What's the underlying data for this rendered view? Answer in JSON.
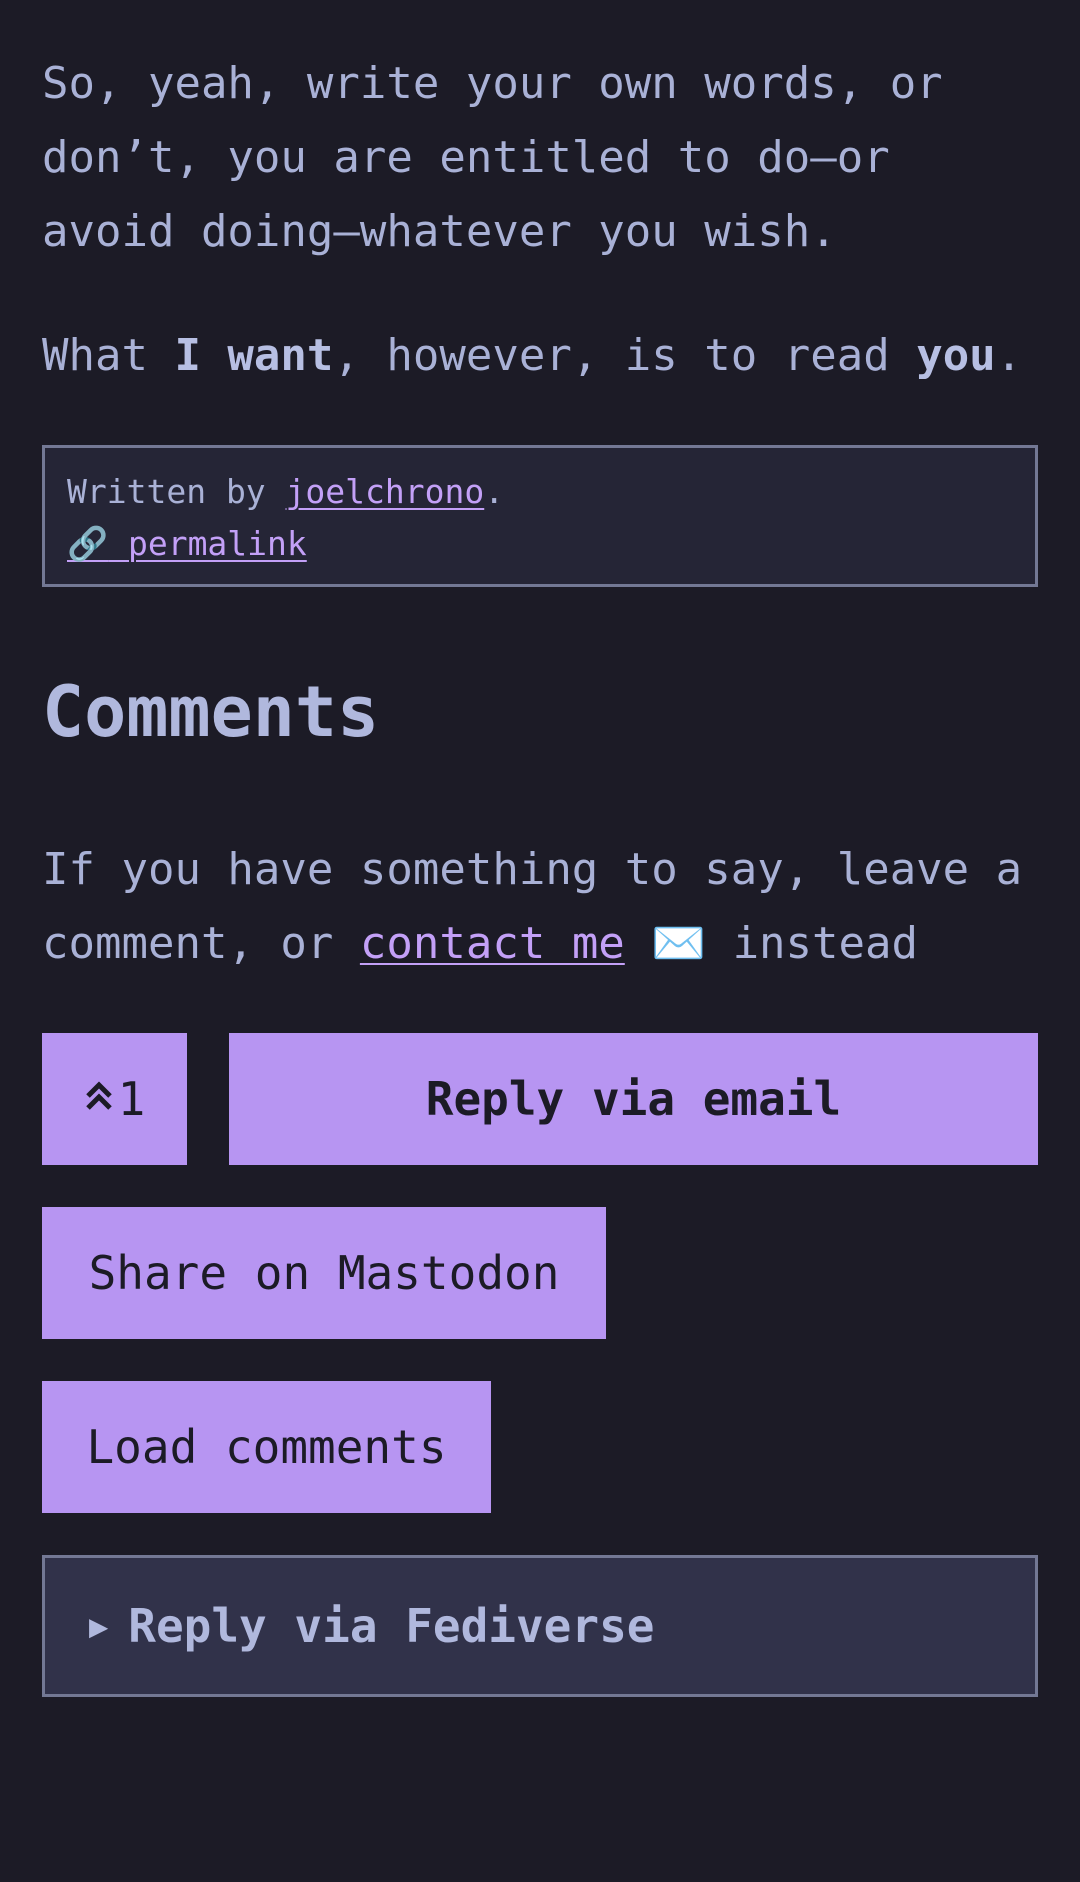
{
  "post": {
    "p1": "So, yeah, write your own words, or don’t, you are entitled to do—or avoid doing—whatever you wish.",
    "p2_a": "What ",
    "p2_strong1": "I want",
    "p2_b": ", however, is to read ",
    "p2_strong2": "you",
    "p2_c": "."
  },
  "meta": {
    "written_by": "Written by ",
    "author": "joelchrono",
    "period": ".",
    "permalink_icon": "🔗",
    "permalink_label": " permalink"
  },
  "comments": {
    "heading": "Comments",
    "intro_a": "If you have something to say, leave a comment, or ",
    "contact_label": "contact me",
    "envelope_icon": " ✉️ ",
    "intro_b": "instead",
    "upvote_icon": "»",
    "upvote_count": "1",
    "reply_email": "Reply via email",
    "share_mastodon": "Share on Mastodon",
    "load_comments": "Load comments",
    "fedi_triangle": "▶",
    "reply_fediverse": "Reply via Fediverse"
  },
  "colors": {
    "background": "#1c1b26",
    "text": "#a9b1d6",
    "accent": "#b795f2",
    "link": "#c3a0f7"
  }
}
